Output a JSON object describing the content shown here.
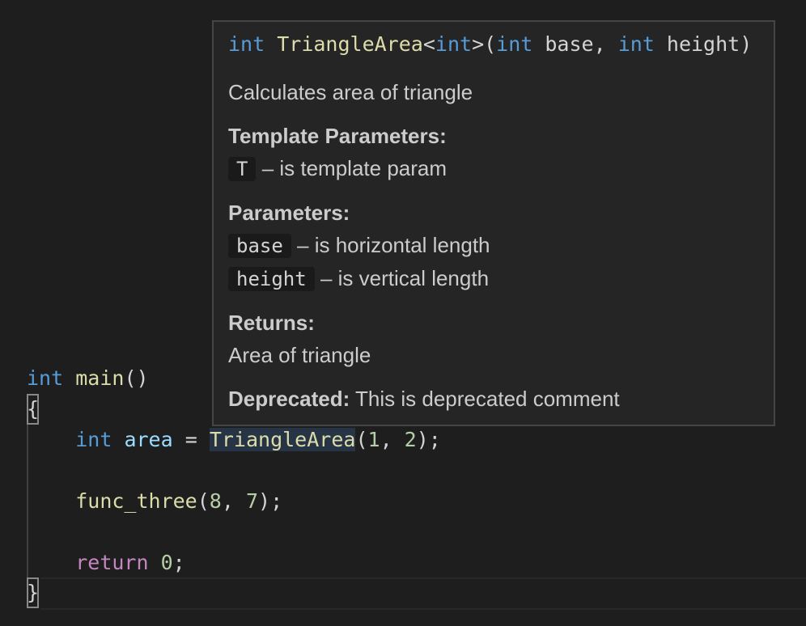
{
  "code": {
    "line1": {
      "kw": "int",
      "fn": "main",
      "punc": "()"
    },
    "line2": {
      "brace_open": "{"
    },
    "line3": {
      "kw": "int",
      "var": "area",
      "eq": " = ",
      "fn": "TriangleArea",
      "lparen": "(",
      "arg1": "1",
      "comma": ", ",
      "arg2": "2",
      "rparen": ");"
    },
    "line4": {
      "fn": "func_three",
      "lparen": "(",
      "arg1": "8",
      "comma": ", ",
      "arg2": "7",
      "rparen": ");"
    },
    "line5": {
      "ctrl": "return",
      "num": "0",
      "semi": ";"
    },
    "line6": {
      "brace_close": "}"
    }
  },
  "hover": {
    "signature": {
      "ret": "int",
      "name": "TriangleArea",
      "lt": "<",
      "tparam": "int",
      "gt_paren": ">(",
      "p1_type": "int",
      "p1_name": " base, ",
      "p2_type": "int",
      "p2_name": " height)"
    },
    "description": "Calculates area of triangle",
    "template_heading": "Template Parameters:",
    "template_params": [
      {
        "name": "T",
        "desc": "– is template param"
      }
    ],
    "params_heading": "Parameters:",
    "params": [
      {
        "name": "base",
        "desc": "– is horizontal length"
      },
      {
        "name": "height",
        "desc": "– is vertical length"
      }
    ],
    "returns_heading": "Returns:",
    "returns_text": "Area of triangle",
    "deprecated_label": "Deprecated:",
    "deprecated_text": "This is deprecated comment"
  },
  "colors": {
    "background": "#1e1e1e",
    "keyword": "#569cd6",
    "function": "#dcdcaa",
    "variable": "#9cdcfe",
    "number": "#b5cea8",
    "control": "#c586c0",
    "hover_background": "#252526",
    "hover_border": "#454545"
  }
}
